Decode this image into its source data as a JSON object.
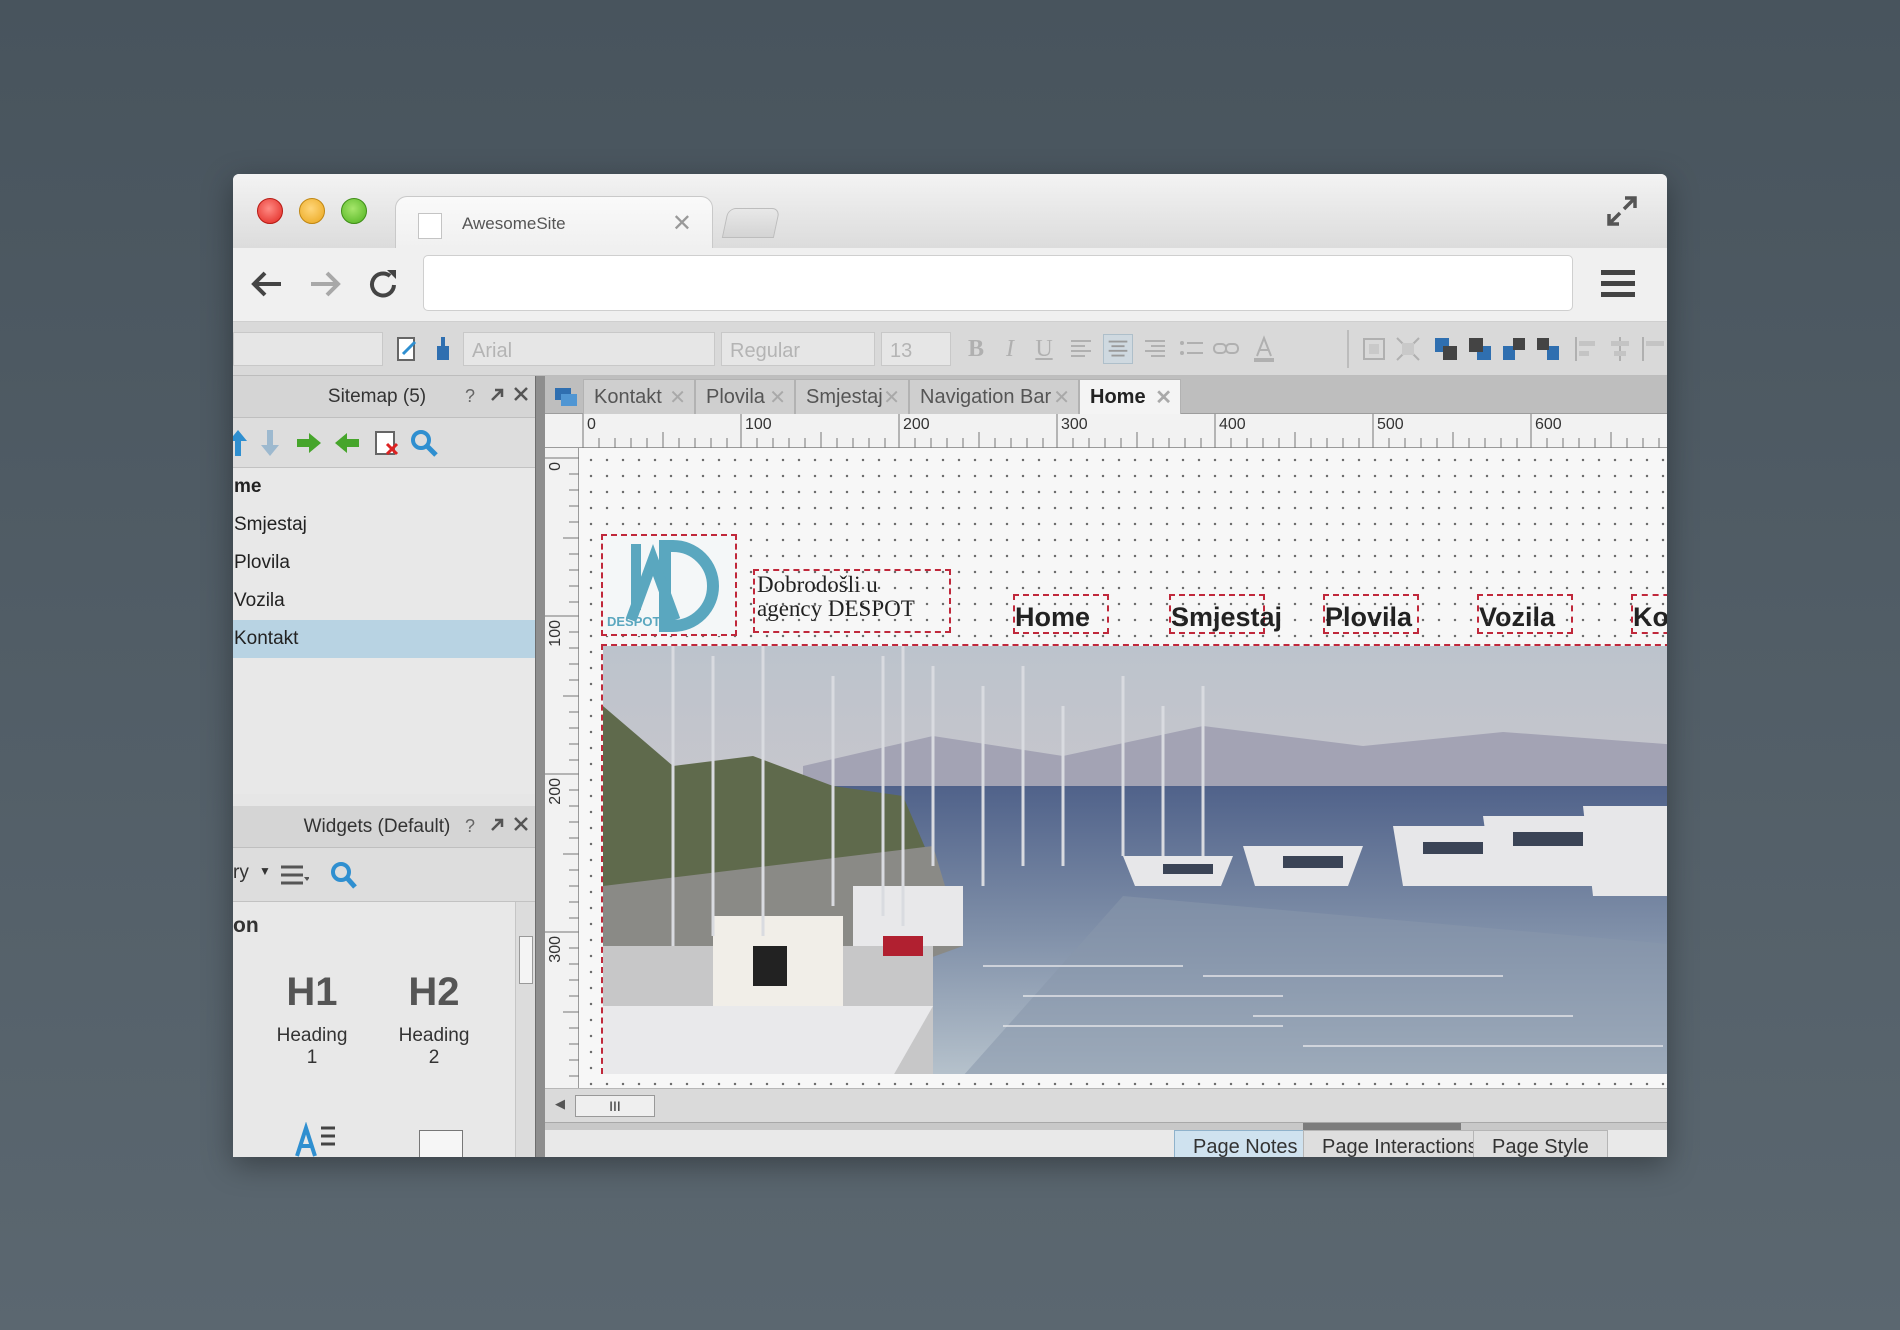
{
  "browser": {
    "tab_title": "AwesomeSite",
    "tab_close": "✕",
    "address": ""
  },
  "toolbar": {
    "font_family": "Arial",
    "font_style": "Regular",
    "font_size": "13",
    "bold": "B",
    "italic": "I",
    "underline": "U"
  },
  "sitemap": {
    "title": "Sitemap (5)",
    "help": "?",
    "items": [
      {
        "label": "me"
      },
      {
        "label": "Smjestaj"
      },
      {
        "label": "Plovila"
      },
      {
        "label": "Vozila"
      },
      {
        "label": "Kontakt"
      }
    ],
    "selected_index": 4
  },
  "widgets": {
    "title": "Widgets (Default)",
    "help": "?",
    "library_label": "ry",
    "section_label": "on",
    "items": [
      {
        "glyph": "H1",
        "label": "Heading 1"
      },
      {
        "glyph": "H2",
        "label": "Heading 2"
      }
    ]
  },
  "doc_tabs": [
    {
      "label": "Kontakt",
      "active": false
    },
    {
      "label": "Plovila",
      "active": false
    },
    {
      "label": "Smjestaj",
      "active": false
    },
    {
      "label": "Navigation Bar",
      "active": false
    },
    {
      "label": "Home",
      "active": true
    }
  ],
  "ruler": {
    "top_labels": [
      "0",
      "100",
      "200",
      "300",
      "400",
      "500",
      "600"
    ],
    "left_labels": [
      "0",
      "100",
      "200",
      "300"
    ]
  },
  "design": {
    "logo_text": "DESPOT",
    "welcome_line1": "Dobrodošli u",
    "welcome_line2": "agency DESPOT",
    "nav": [
      "Home",
      "Smjestaj",
      "Plovila",
      "Vozila",
      "Ko"
    ]
  },
  "scroll_label": "III",
  "bottom_tabs": [
    {
      "label": "Page Notes",
      "active": true
    },
    {
      "label": "Page Interactions",
      "active": false
    },
    {
      "label": "Page Style",
      "active": false
    }
  ],
  "colors": {
    "accent": "#2f8fd0",
    "selection": "#b8d3e3",
    "dashed_outline": "#c0283b",
    "logo": "#5aa7bf"
  }
}
